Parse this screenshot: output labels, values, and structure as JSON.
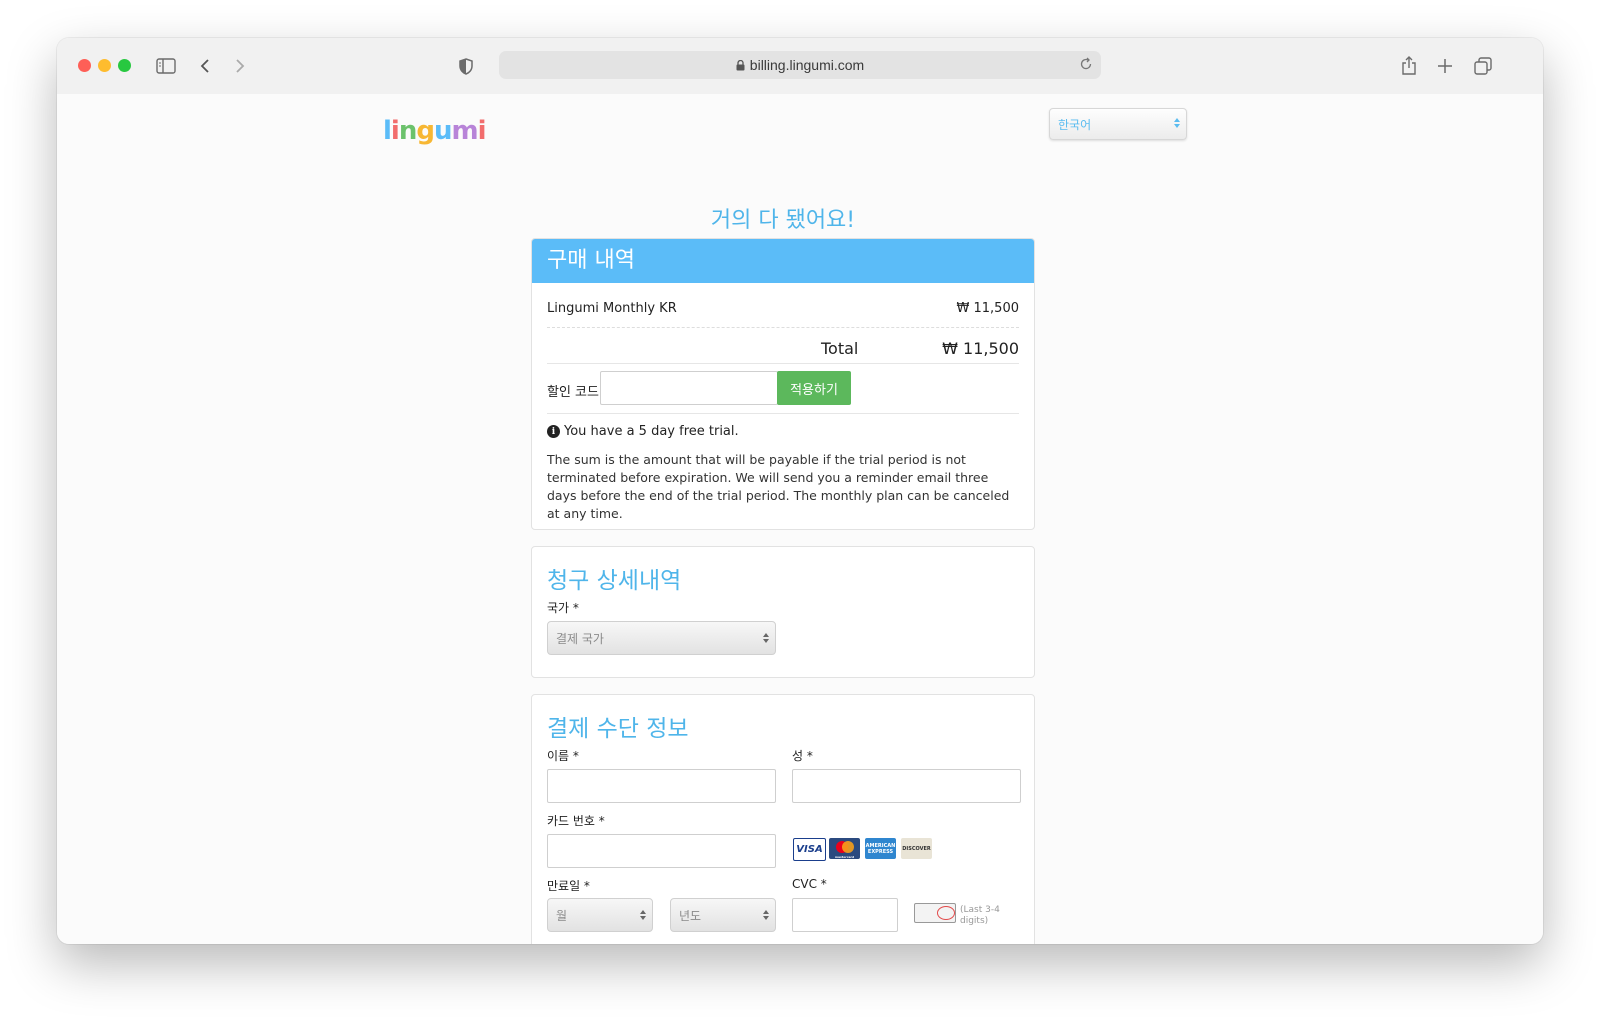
{
  "browser": {
    "url": "billing.lingumi.com"
  },
  "header": {
    "logo_text": "lingumi",
    "language_selected": "한국어"
  },
  "page": {
    "headline": "거의 다 됐어요!"
  },
  "purchase": {
    "title": "구매 내역",
    "item_name": "Lingumi Monthly KR",
    "item_price": "₩ 11,500",
    "total_label": "Total",
    "total_price": "₩ 11,500",
    "discount_label": "할인 코드",
    "discount_value": "",
    "apply_label": "적용하기",
    "trial_notice": "You have a 5 day free trial.",
    "trial_description": "The sum is the amount that will be payable if the trial period is not terminated before expiration. We will send you a reminder email three days before the end of the trial period. The monthly plan can be canceled at any time."
  },
  "billing": {
    "title": "청구 상세내역",
    "country_label": "국가 *",
    "country_placeholder": "결제 국가"
  },
  "payment": {
    "title": "결제 수단 정보",
    "first_name_label": "이름 *",
    "last_name_label": "성 *",
    "card_number_label": "카드 번호 *",
    "expiry_label": "만료일 *",
    "month_placeholder": "월",
    "year_placeholder": "년도",
    "cvc_label": "CVC *",
    "cvc_hint": "(Last 3-4 digits)",
    "card_brands": [
      "VISA",
      "mastercard",
      "AMERICAN EXPRESS",
      "DISCOVER"
    ]
  },
  "colors": {
    "accent": "#5bbcf8",
    "apply_button": "#5cb85c"
  }
}
